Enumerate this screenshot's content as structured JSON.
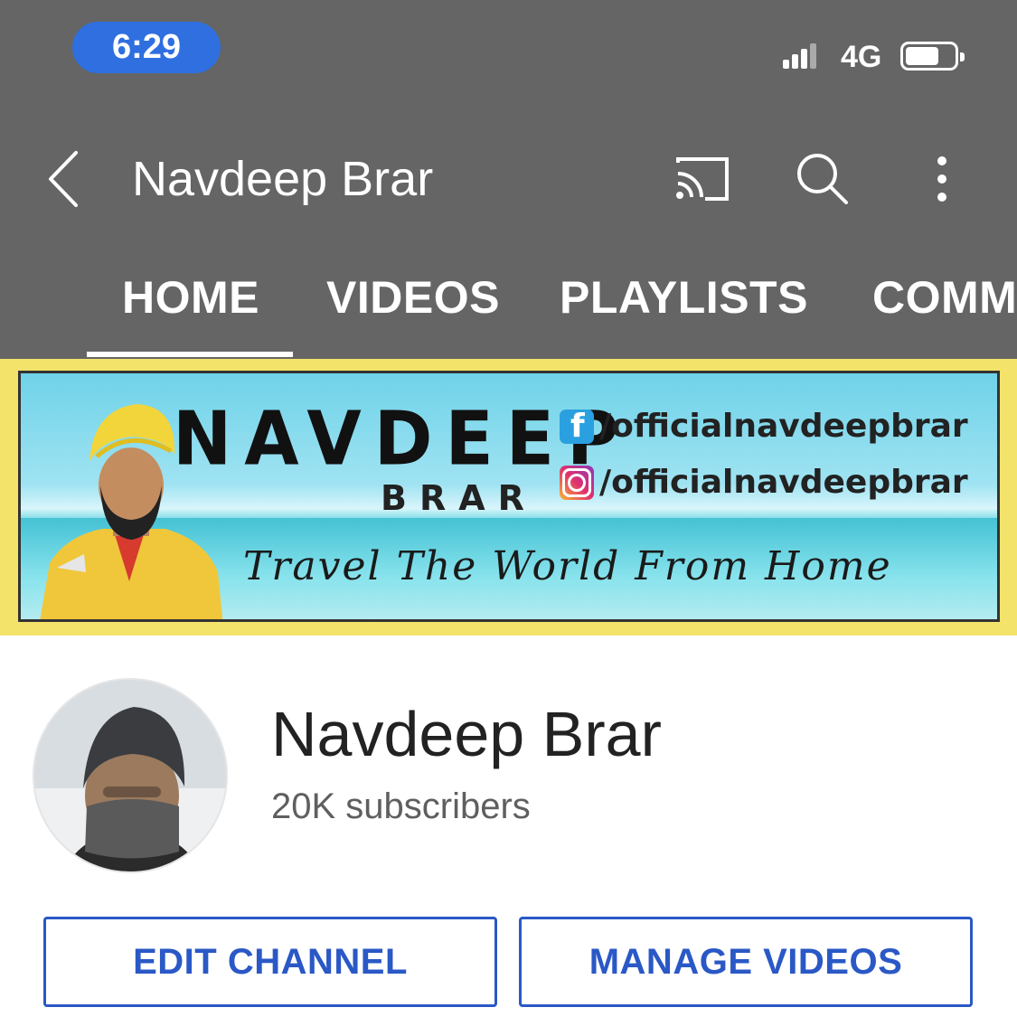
{
  "status_bar": {
    "time": "6:29",
    "network": "4G"
  },
  "header": {
    "title": "Navdeep Brar"
  },
  "tabs": [
    {
      "label": "HOME",
      "active": true
    },
    {
      "label": "VIDEOS",
      "active": false
    },
    {
      "label": "PLAYLISTS",
      "active": false
    },
    {
      "label": "COMM",
      "active": false
    }
  ],
  "banner": {
    "brand_top": "NAVDEEP",
    "brand_bottom": "BRAR",
    "facebook_handle": "/officialnavdeepbrar",
    "instagram_handle": "/officialnavdeepbrar",
    "tagline": "Travel The World From Home"
  },
  "channel": {
    "name": "Navdeep Brar",
    "subscribers": "20K subscribers"
  },
  "actions": {
    "edit_label": "EDIT CHANNEL",
    "manage_label": "MANAGE VIDEOS"
  },
  "colors": {
    "header_bg": "#656565",
    "accent_blue": "#2a58c6",
    "time_pill": "#2f6fe0",
    "banner_frame": "#f3e36b"
  }
}
